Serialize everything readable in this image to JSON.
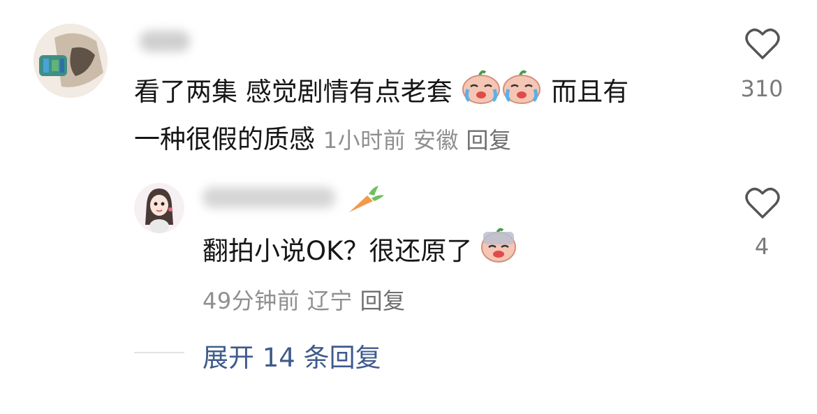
{
  "comment": {
    "text_line1_a": "看了两集  感觉剧情有点老套",
    "text_line1_b": "而且有",
    "text_line2": "一种很假的质感",
    "time": "1小时前",
    "location": "安徽",
    "reply_label": "回复",
    "like_count": "310",
    "emojis": [
      "crying-peach-emoji",
      "crying-peach-emoji"
    ]
  },
  "reply": {
    "text": "翻拍小说OK？很还原了",
    "time": "49分钟前",
    "location": "辽宁",
    "reply_label": "回复",
    "like_count": "4",
    "emojis": [
      "facepalm-peach-emoji"
    ],
    "badge_icon": "carrot-icon"
  },
  "expand": {
    "label": "展开 14 条回复"
  },
  "colors": {
    "text": "#161616",
    "meta": "#8f8f8f",
    "link": "#3f5a8c",
    "icon": "#555555"
  }
}
